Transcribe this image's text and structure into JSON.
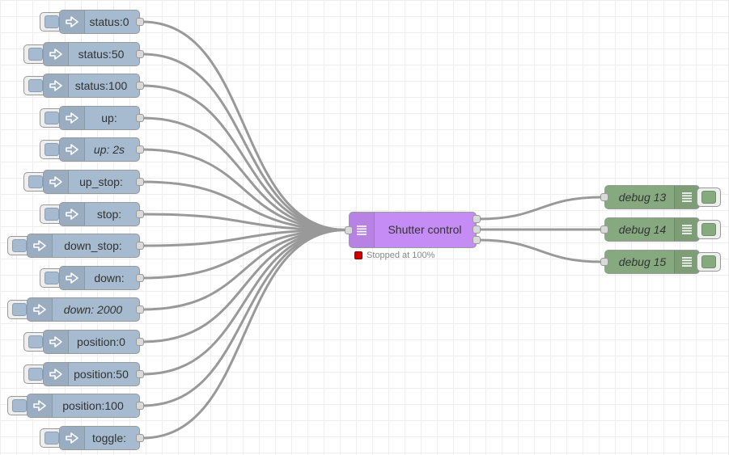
{
  "colors": {
    "inject": "#a6bbcf",
    "function": "#c58cf5",
    "debug": "#87a980",
    "wire": "#999999",
    "status_red": "#cc0000"
  },
  "icons": {
    "inject": "arrow-in-icon",
    "function": "list-icon",
    "debug": "list-icon"
  },
  "inject_nodes": [
    {
      "label": "status:0",
      "italic": false
    },
    {
      "label": "status:50",
      "italic": false
    },
    {
      "label": "status:100",
      "italic": false
    },
    {
      "label": "up:",
      "italic": false
    },
    {
      "label": "up: 2s",
      "italic": true
    },
    {
      "label": "up_stop:",
      "italic": false
    },
    {
      "label": "stop:",
      "italic": false
    },
    {
      "label": "down_stop:",
      "italic": false
    },
    {
      "label": "down:",
      "italic": false
    },
    {
      "label": "down: 2000",
      "italic": true
    },
    {
      "label": "position:0",
      "italic": false
    },
    {
      "label": "position:50",
      "italic": false
    },
    {
      "label": "position:100",
      "italic": false
    },
    {
      "label": "toggle:",
      "italic": false
    }
  ],
  "shutter_node": {
    "label": "Shutter control",
    "status_text": "Stopped at 100%"
  },
  "debug_nodes": [
    {
      "label": "debug 13",
      "italic": true
    },
    {
      "label": "debug 14",
      "italic": true
    },
    {
      "label": "debug 15",
      "italic": true
    }
  ]
}
